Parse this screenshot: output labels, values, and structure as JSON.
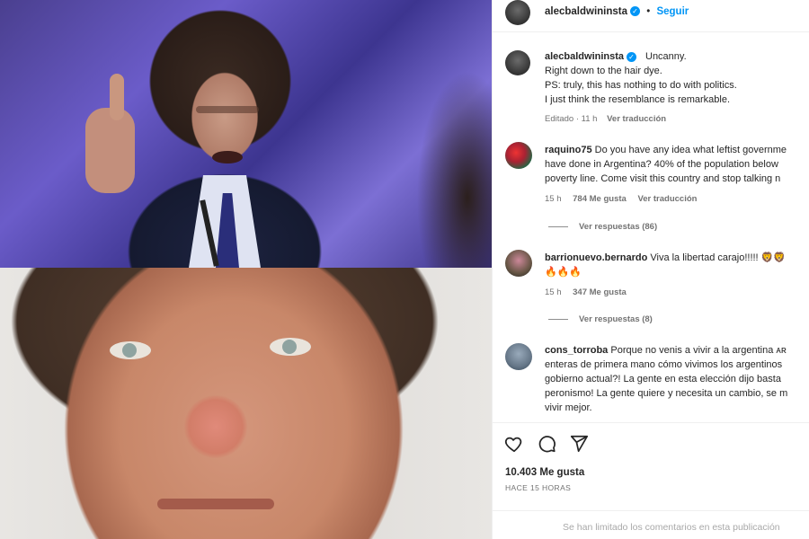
{
  "post": {
    "username": "alecbaldwininsta",
    "verified_glyph": "✓",
    "follow_label": "Seguir",
    "separator": "•",
    "caption_lines": [
      "Uncanny.",
      "Right down to the hair dye.",
      "PS: truly, this has nothing to do with politics.",
      "I just think the resemblance is remarkable."
    ],
    "caption_meta_time": "Editado · 11 h",
    "caption_meta_translate": "Ver traducción",
    "likes": "10.403 Me gusta",
    "time_ago": "HACE 15 HORAS",
    "comments_limited": "Se han limitado los comentarios en esta publicación"
  },
  "comments": [
    {
      "username": "raquino75",
      "lines": [
        "Do you have any idea what leftist governme",
        "have done in Argentina? 40% of the population below",
        "poverty line. Come visit this country and stop talking n"
      ],
      "time": "15 h",
      "likes": "784 Me gusta",
      "translate": "Ver traducción",
      "replies": "Ver respuestas (86)"
    },
    {
      "username": "barrionuevo.bernardo",
      "lines": [
        "Viva la libertad carajo!!!!! 🦁🦁",
        "🔥🔥🔥"
      ],
      "time": "15 h",
      "likes": "347 Me gusta",
      "replies": "Ver respuestas (8)"
    },
    {
      "username": "cons_torroba",
      "lines": [
        "Porque no venis a vivir a la argentina ᴀʀ",
        "enteras de primera mano cómo vivimos los argentinos",
        "gobierno actual?! La gente en esta elección dijo basta",
        "peronismo! La gente quiere y necesita un cambio, se m",
        "vivir mejor."
      ]
    }
  ],
  "icons": {
    "like": "heart-icon",
    "comment": "comment-icon",
    "share": "share-icon",
    "verified": "verified-badge-icon"
  },
  "colors": {
    "accent": "#0095f6",
    "muted": "#737373",
    "text": "#262626"
  }
}
